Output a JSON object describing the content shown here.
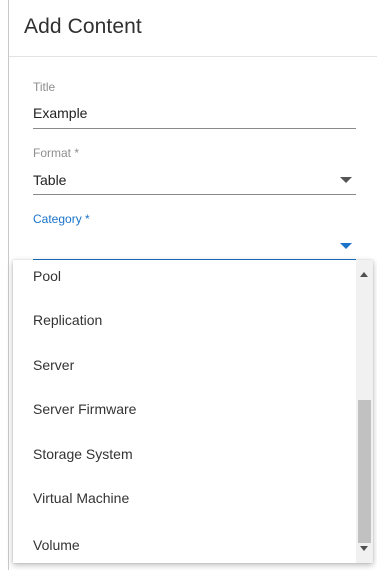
{
  "dialog": {
    "title": "Add Content"
  },
  "form": {
    "title_field": {
      "label": "Title",
      "value": "Example"
    },
    "format_field": {
      "label": "Format *",
      "value": "Table"
    },
    "category_field": {
      "label": "Category *",
      "value": ""
    }
  },
  "dropdown": {
    "options": [
      {
        "label": "Pool"
      },
      {
        "label": "Replication"
      },
      {
        "label": "Server"
      },
      {
        "label": "Server Firmware"
      },
      {
        "label": "Storage System"
      },
      {
        "label": "Virtual Machine"
      },
      {
        "label": "Volume"
      }
    ],
    "scroll_position": 0.62
  },
  "colors": {
    "accent": "#1a73c8",
    "text": "#222222",
    "label": "#8e8e8e"
  }
}
